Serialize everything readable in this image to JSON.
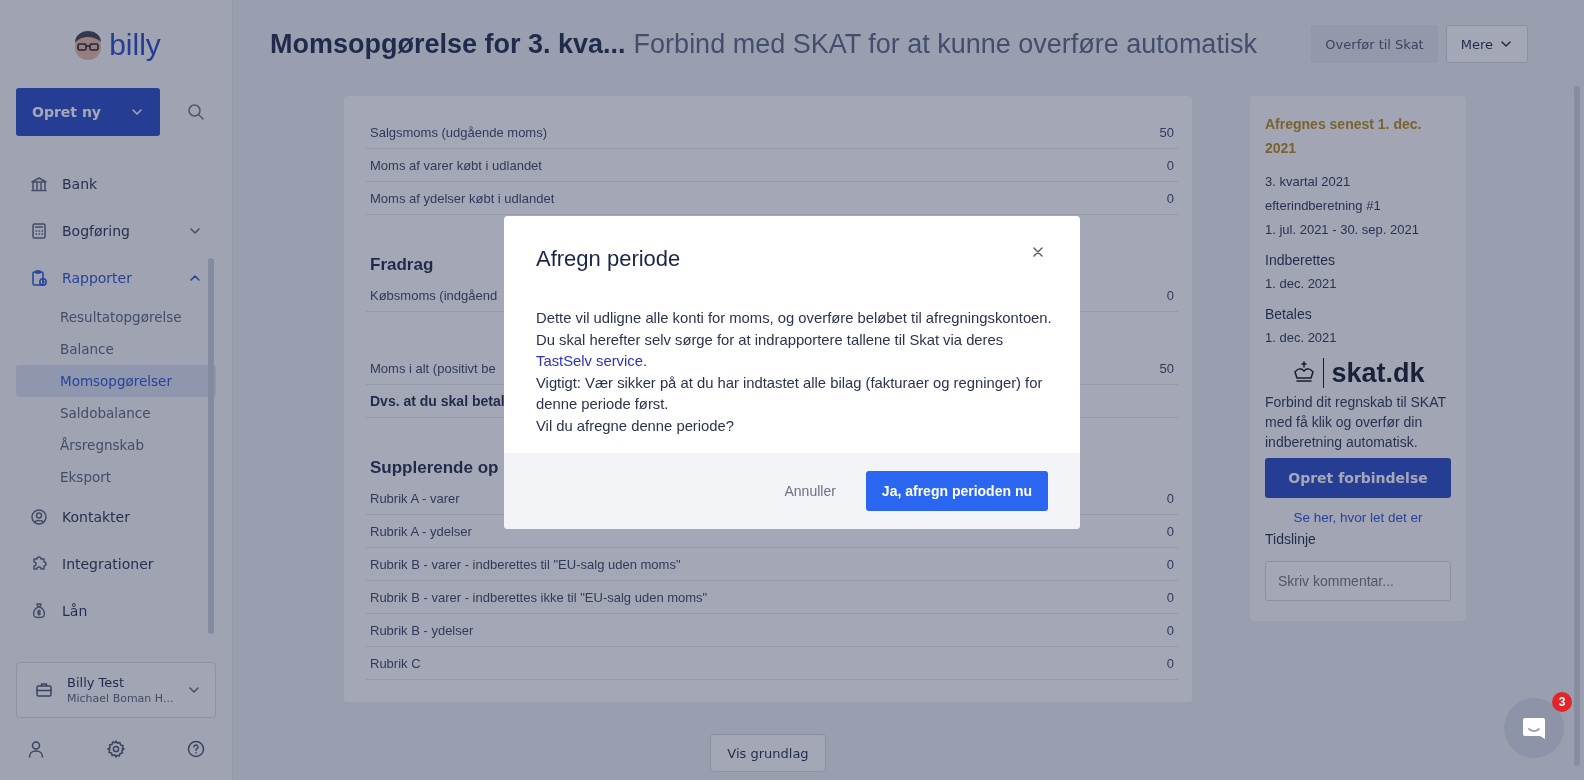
{
  "sidebar": {
    "logo_text": "billy",
    "create_button": "Opret ny",
    "nav": [
      {
        "label": "Bank",
        "kind": "link",
        "selected": false
      },
      {
        "label": "Bogføring",
        "kind": "group",
        "selected": false,
        "expanded": false
      },
      {
        "label": "Rapporter",
        "kind": "group",
        "selected": true,
        "expanded": true,
        "children": [
          {
            "label": "Resultatopgørelse",
            "selected": false
          },
          {
            "label": "Balance",
            "selected": false
          },
          {
            "label": "Momsopgørelser",
            "selected": true
          },
          {
            "label": "Saldobalance",
            "selected": false
          },
          {
            "label": "Årsregnskab",
            "selected": false
          },
          {
            "label": "Eksport",
            "selected": false
          }
        ]
      },
      {
        "label": "Kontakter",
        "kind": "link",
        "selected": false
      },
      {
        "label": "Integrationer",
        "kind": "link",
        "selected": false
      },
      {
        "label": "Lån",
        "kind": "link",
        "selected": false
      }
    ],
    "organization": {
      "name": "Billy Test",
      "owner": "Michael Boman H..."
    }
  },
  "header": {
    "title": "Momsopgørelse for 3. kva...",
    "subtitle": "Forbind med SKAT for at kunne overføre automatisk",
    "buttons": [
      {
        "label": "Overfør til Skat",
        "kind": "plain"
      },
      {
        "label": "Mere",
        "kind": "dropdown"
      }
    ]
  },
  "report": {
    "sections": [
      {
        "rows": [
          {
            "label": "Salgsmoms (udgående moms)",
            "value": "50",
            "kind": "line"
          },
          {
            "label": "Moms af varer købt i udlandet",
            "value": "0",
            "kind": "line"
          },
          {
            "label": "Moms af ydelser købt i udlandet",
            "value": "0",
            "kind": "line"
          }
        ]
      },
      {
        "heading": "Fradrag",
        "rows": [
          {
            "label": "Købsmoms (indgåend",
            "value": "0",
            "kind": "line"
          }
        ]
      },
      {
        "rows": [
          {
            "label": "Moms i alt (positivt be",
            "value": "50",
            "kind": "line"
          },
          {
            "label": "Dvs. at du skal betal",
            "kind": "total"
          }
        ]
      },
      {
        "heading": "Supplerende op",
        "rows": [
          {
            "label": "Rubrik A - varer",
            "value": "0",
            "kind": "line"
          },
          {
            "label": "Rubrik A - ydelser",
            "value": "0",
            "kind": "line"
          },
          {
            "label": "Rubrik B - varer - indberettes til \"EU-salg uden moms\"",
            "value": "0",
            "kind": "line"
          },
          {
            "label": "Rubrik B - varer - indberettes ikke til \"EU-salg uden moms\"",
            "value": "0",
            "kind": "line"
          },
          {
            "label": "Rubrik B - ydelser",
            "value": "0",
            "kind": "line"
          },
          {
            "label": "Rubrik C",
            "value": "0",
            "kind": "line"
          }
        ]
      }
    ],
    "footer_button": "Vis grundlag"
  },
  "summary": {
    "deadline": "Afregnes senest 1. dec. 2021",
    "period_lines": [
      "3. kvartal 2021",
      "efterindberetning #1",
      "1. jul. 2021 - 30. sep. 2021"
    ],
    "dates": [
      {
        "label": "Indberettes",
        "value": "1. dec. 2021"
      },
      {
        "label": "Betales",
        "value": "1. dec. 2021"
      }
    ],
    "logo_text": "skat.dk",
    "description": "Forbind dit regnskab til SKAT med få klik og overfør din indberetning automatisk.",
    "connect_button": "Opret forbindelse",
    "help_link": "Se her, hvor let det er",
    "timeline_heading": "Tidslinje",
    "comment": {
      "placeholder": "Skriv kommentar..."
    }
  },
  "dialog": {
    "title": "Afregn periode",
    "paragraphs": [
      {
        "text": "Dette vil udligne alle konti for moms, og overføre beløbet til afregningskontoen."
      },
      {
        "text": "Du skal herefter selv sørge for at indrapportere tallene til Skat via deres ",
        "link": "TastSelv service",
        "after": "."
      },
      {
        "text": "Vigtigt: Vær sikker på at du har indtastet alle bilag (fakturaer og regninger) for denne periode først."
      },
      {
        "text": "Vil du afregne denne periode?"
      }
    ],
    "cancel": "Annuller",
    "confirm": "Ja, afregn perioden nu"
  },
  "chat": {
    "badge": "3"
  }
}
